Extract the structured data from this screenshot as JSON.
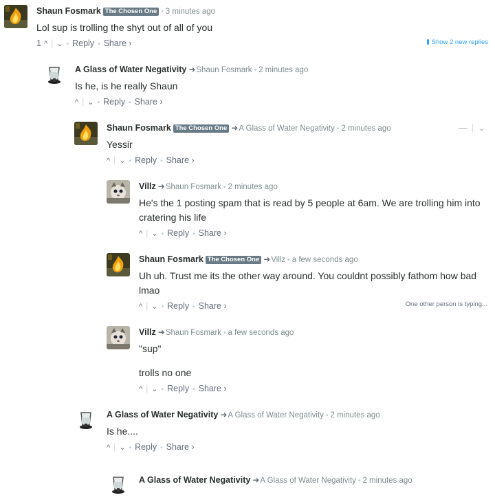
{
  "labels": {
    "reply": "Reply",
    "share": "Share ›",
    "upvote": "^",
    "downvote": "⌄",
    "reply_arrow": "➜",
    "show_new_replies": "Show 2 new replies",
    "typing": "One other person is typing...",
    "collapse": "—",
    "dropdown": "⌄"
  },
  "comments": [
    {
      "author": "Shaun Fosmark",
      "badge": "The Chosen One",
      "parent": "",
      "time": "3 minutes ago",
      "paragraphs": [
        "Lol sup is trolling the shyt out of all of you"
      ],
      "vote_count": "1",
      "avatar": "fire"
    },
    {
      "author": "A Glass of Water Negativity",
      "badge": "",
      "parent": "Shaun Fosmark",
      "time": "2 minutes ago",
      "paragraphs": [
        "Is he, is he really Shaun"
      ],
      "vote_count": "",
      "avatar": "glass"
    },
    {
      "author": "Shaun Fosmark",
      "badge": "The Chosen One",
      "parent": "A Glass of Water Negativity",
      "time": "2 minutes ago",
      "paragraphs": [
        "Yessir"
      ],
      "vote_count": "",
      "avatar": "fire"
    },
    {
      "author": "Villz",
      "badge": "",
      "parent": "Shaun Fosmark",
      "time": "2 minutes ago",
      "paragraphs": [
        "He's the 1 posting spam that is read by 5 people at 6am. We are trolling him into",
        "cratering his life"
      ],
      "vote_count": "",
      "avatar": "cat"
    },
    {
      "author": "Shaun Fosmark",
      "badge": "The Chosen One",
      "parent": "Villz",
      "time": "a few seconds ago",
      "paragraphs": [
        "Uh uh. Trust me its the other way around. You couldnt possibly fathom how bad",
        "lmao"
      ],
      "vote_count": "",
      "avatar": "fire"
    },
    {
      "author": "Villz",
      "badge": "",
      "parent": "Shaun Fosmark",
      "time": "a few seconds ago",
      "paragraphs": [
        "\"sup\"",
        "trolls no one"
      ],
      "vote_count": "",
      "avatar": "cat"
    },
    {
      "author": "A Glass of Water Negativity",
      "badge": "",
      "parent": "A Glass of Water Negativity",
      "time": "2 minutes ago",
      "paragraphs": [
        "Is he...."
      ],
      "vote_count": "",
      "avatar": "glass"
    },
    {
      "author": "A Glass of Water Negativity",
      "badge": "",
      "parent": "A Glass of Water Negativity",
      "time": "2 minutes ago",
      "paragraphs": [],
      "vote_count": "",
      "avatar": "glass"
    }
  ]
}
